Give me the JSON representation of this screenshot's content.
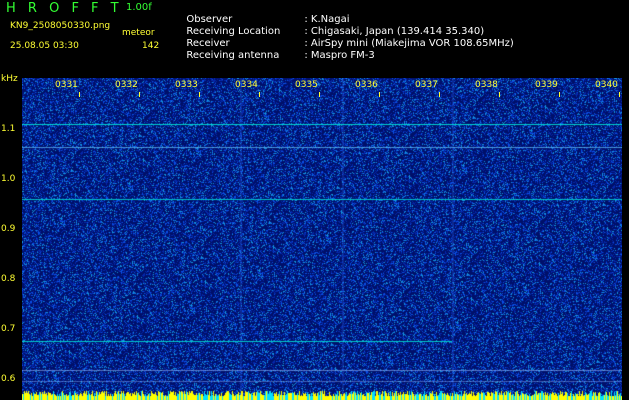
{
  "header": {
    "app_title": "H R O F F T",
    "version": "1.00f",
    "filename": "KN9_2508050330.png",
    "mode": "meteor",
    "datetime": "25.08.05 03:30",
    "count": "142"
  },
  "meta": [
    {
      "key": "Observer",
      "value": ": K.Nagai"
    },
    {
      "key": "Receiving Location",
      "value": ": Chigasaki, Japan (139.414 35.340)"
    },
    {
      "key": "Receiver",
      "value": ": AirSpy mini (Miakejima VOR 108.65MHz)"
    },
    {
      "key": "Receiving antenna",
      "value": ": Maspro FM-3"
    }
  ],
  "spectrogram": {
    "y_unit": "kHz",
    "y_ticks": [
      "1.1",
      "1.0",
      "0.9",
      "0.8",
      "0.7",
      "0.6"
    ],
    "x_ticks": [
      "0331",
      "0332",
      "0333",
      "0334",
      "0335",
      "0336",
      "0337",
      "0338",
      "0339",
      "0340"
    ],
    "colors": {
      "background": "#00106a",
      "noise": "#1e5cff",
      "signal": "#00e8d8",
      "baseline_yellow": "#ffff00"
    }
  }
}
